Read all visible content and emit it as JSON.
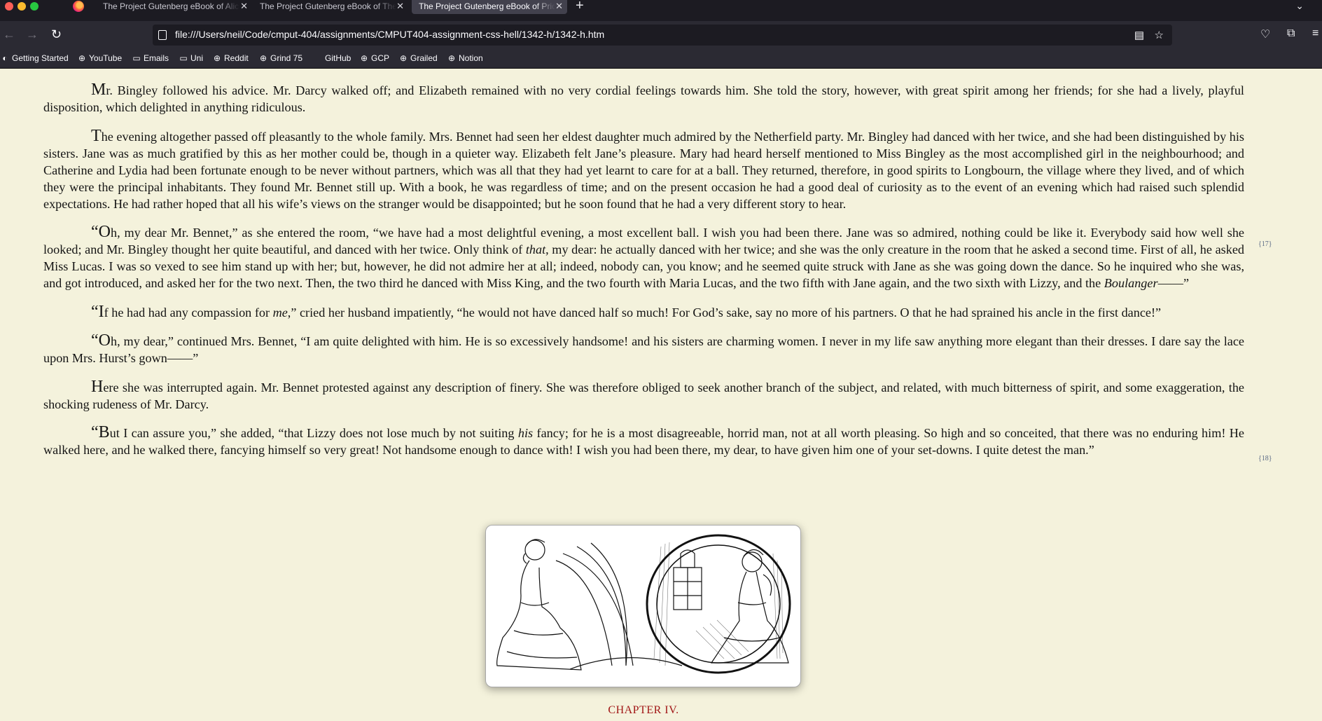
{
  "browser": {
    "tabs": [
      {
        "title": "The Project Gutenberg eBook of Alice",
        "active": false
      },
      {
        "title": "The Project Gutenberg eBook of The",
        "active": false
      },
      {
        "title": "The Project Gutenberg eBook of Pride",
        "active": true
      }
    ],
    "new_tab_label": "+",
    "url": "file:///Users/neil/Code/cmput-404/assignments/CMPUT404-assignment-css-hell/1342-h/1342-h.htm",
    "bookmarks": [
      {
        "label": "Getting Started",
        "icon": "firefox-icon"
      },
      {
        "label": "YouTube",
        "icon": "globe-icon"
      },
      {
        "label": "Emails",
        "icon": "folder-icon"
      },
      {
        "label": "Uni",
        "icon": "folder-icon"
      },
      {
        "label": "Reddit",
        "icon": "globe-icon"
      },
      {
        "label": "Grind 75",
        "icon": "globe-icon"
      },
      {
        "label": "GitHub",
        "icon": "github-icon"
      },
      {
        "label": "GCP",
        "icon": "globe-icon"
      },
      {
        "label": "Grailed",
        "icon": "globe-icon"
      },
      {
        "label": "Notion",
        "icon": "globe-icon"
      }
    ]
  },
  "book": {
    "paragraphs": [
      {
        "cap": "M",
        "text": "r. Bingley followed his advice. Mr. Darcy walked off; and Elizabeth remained with no very cordial feelings towards him. She told the story, however, with great spirit among her friends; for she had a lively, playful disposition, which delighted in anything ridiculous."
      },
      {
        "cap": "T",
        "text": "he evening altogether passed off pleasantly to the whole family. Mrs. Bennet had seen her eldest daughter much admired by the Netherfield party. Mr. Bingley had danced with her twice, and she had been distinguished by his sisters. Jane was as much gratified by this as her mother could be, though in a quieter way. Elizabeth felt Jane’s pleasure. Mary had heard herself mentioned to Miss Bingley as the most accomplished girl in the neighbourhood; and Catherine and Lydia had been fortunate enough to be never without partners, which was all that they had yet learnt to care for at a ball. They returned, therefore, in good spirits to Longbourn, the village where they lived, and of which they were the principal inhabitants. They found Mr. Bennet still up. With a book, he was regardless of time; and on the present occasion he had a good deal of curiosity as to the event of an evening which had raised such splendid expectations. He had rather hoped that all his wife’s views on the stranger would be disappointed; but he soon found that he had a very different story to hear."
      },
      {
        "cap": "“O",
        "text_a": "h, my dear Mr. Bennet,” as she entered the room, “we have had a most delightful evening, a most excellent ball. I wish you had been there. Jane was so admired, nothing could be like it. Everybody said how well she looked; and Mr. Bingley thought her quite beautiful, and danced with her twice. Only think of ",
        "em_a": "that",
        "text_b": ", my dear: he actually danced with her twice; and she was the only creature in the room that he asked a second time. First of all, he asked Miss Lucas. I was so vexed to see him stand up with her; but, however, he did not admire her at all; indeed, nobody can, you know; and he seemed quite struck with Jane as she was going down the dance. So he inquired who she was, and got introduced, and asked her for the two next. Then, the two third he danced with Miss King, and the two fourth with Maria Lucas, and the two fifth with Jane again, and the two sixth with Lizzy, and the ",
        "em_b": "Boulanger",
        "text_c": "——”"
      },
      {
        "cap": "“I",
        "text_a": "f he had had any compassion for ",
        "em_a": "me",
        "text_b": ",” cried her husband impatiently, “he would not have danced half so much! For God’s sake, say no more of his partners. O that he had sprained his ancle in the first dance!”"
      },
      {
        "cap": "“O",
        "text": "h, my dear,” continued Mrs. Bennet, “I am quite delighted with him. He is so excessively handsome! and his sisters are charming women. I never in my life saw anything more elegant than their dresses. I dare say the lace upon Mrs. Hurst’s gown——”"
      },
      {
        "cap": "H",
        "text": "ere she was interrupted again. Mr. Bennet protested against any description of finery. She was therefore obliged to seek another branch of the subject, and related, with much bitterness of spirit, and some exaggeration, the shocking rudeness of Mr. Darcy."
      },
      {
        "cap": "“B",
        "text_a": "ut I can assure you,” she added, “that Lizzy does not lose much by not suiting ",
        "em_a": "his",
        "text_b": " fancy; for he is a most disagreeable, horrid man, not at all worth pleasing. So high and so conceited, that there was no enduring him! He walked here, and he walked there, fancying himself so very great! Not handsome enough to dance with! I wish you had been there, my dear, to have given him one of your set-downs. I quite detest the man.”"
      }
    ],
    "page_numbers": [
      "{17}",
      "{18}"
    ],
    "chapter_heading": "CHAPTER IV."
  }
}
